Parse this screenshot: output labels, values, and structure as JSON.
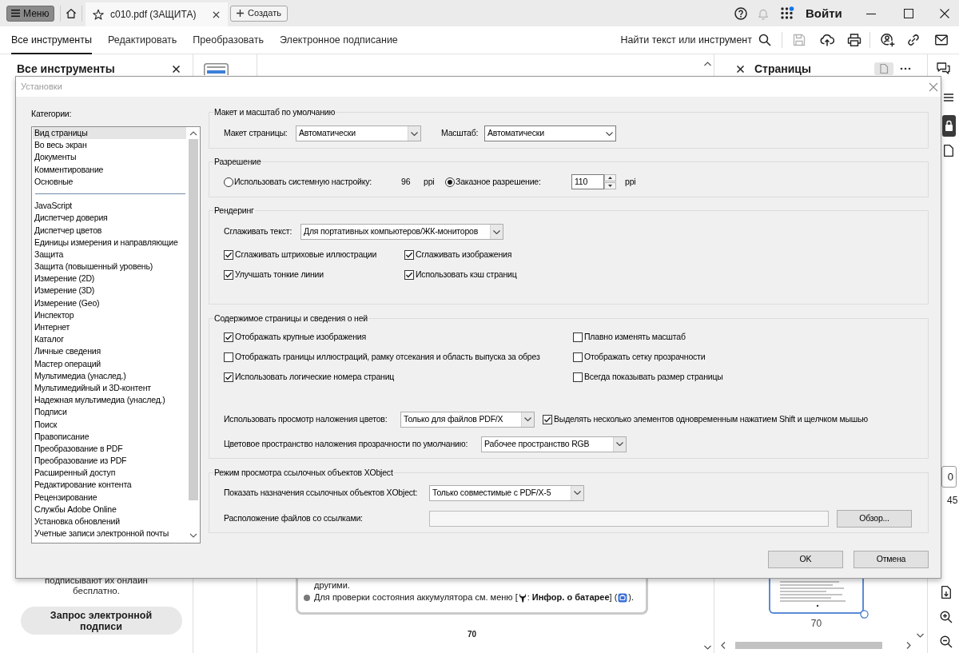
{
  "title_bar": {
    "menu_button": "Меню",
    "document_tab": "c010.pdf (ЗАЩИТА)",
    "create_button": "Создать",
    "sign_in": "Войти"
  },
  "toolbar": {
    "tabs": [
      {
        "label": "Все инструменты",
        "selected": true
      },
      {
        "label": "Редактировать",
        "selected": false
      },
      {
        "label": "Преобразовать",
        "selected": false
      },
      {
        "label": "Электронное подписание",
        "selected": false
      }
    ],
    "search": "Найти текст или инструмент"
  },
  "tools_panel": {
    "title": "Все инструменты",
    "note": "подписывают их онлайн бесплатно.",
    "request_button": "Запрос электронной подписи"
  },
  "document": {
    "continued_line": "другими.",
    "bullet_parts": [
      "Для проверки состояния аккумулятора см. меню [",
      ": **Инфор. о батарее**] (",
      ")."
    ],
    "page_number": "70"
  },
  "pages_panel": {
    "title": "Страницы",
    "thumbnail_label": "70"
  },
  "right_rail": {
    "page_field": "0",
    "page_count": "45"
  },
  "dialog": {
    "title": "Установки",
    "categories_label": "Категории:",
    "categories": {
      "pinned": [
        {
          "label": "Вид страницы",
          "selected": true
        },
        {
          "label": "Во весь экран",
          "selected": false
        },
        {
          "label": "Документы",
          "selected": false
        },
        {
          "label": "Комментирование",
          "selected": false
        },
        {
          "label": "Основные",
          "selected": false
        }
      ],
      "others": [
        {
          "label": "JavaScript",
          "selected": false
        },
        {
          "label": "Диспетчер доверия",
          "selected": false
        },
        {
          "label": "Диспетчер цветов",
          "selected": false
        },
        {
          "label": "Единицы измерения и направляющие",
          "selected": false
        },
        {
          "label": "Защита",
          "selected": false
        },
        {
          "label": "Защита (повышенный уровень)",
          "selected": false
        },
        {
          "label": "Измерение (2D)",
          "selected": false
        },
        {
          "label": "Измерение (3D)",
          "selected": false
        },
        {
          "label": "Измерение (Geo)",
          "selected": false
        },
        {
          "label": "Инспектор",
          "selected": false
        },
        {
          "label": "Интернет",
          "selected": false
        },
        {
          "label": "Каталог",
          "selected": false
        },
        {
          "label": "Личные сведения",
          "selected": false
        },
        {
          "label": "Мастер операций",
          "selected": false
        },
        {
          "label": "Мультимедиа (унаслед.)",
          "selected": false
        },
        {
          "label": "Мультимедийный и 3D-контент",
          "selected": false
        },
        {
          "label": "Надежная мультимедиа (унаслед.)",
          "selected": false
        },
        {
          "label": "Подписи",
          "selected": false
        },
        {
          "label": "Поиск",
          "selected": false
        },
        {
          "label": "Правописание",
          "selected": false
        },
        {
          "label": "Преобразование в PDF",
          "selected": false
        },
        {
          "label": "Преобразование из PDF",
          "selected": false
        },
        {
          "label": "Расширенный доступ",
          "selected": false
        },
        {
          "label": "Редактирование контента",
          "selected": false
        },
        {
          "label": "Рецензирование",
          "selected": false
        },
        {
          "label": "Службы Adobe Online",
          "selected": false
        },
        {
          "label": "Установка обновлений",
          "selected": false
        },
        {
          "label": "Учетные записи электронной почты",
          "selected": false
        }
      ]
    },
    "layout_zoom": {
      "title": "Макет и масштаб по умолчанию",
      "page_layout": {
        "label": "Макет страницы:",
        "value": "Автоматически"
      },
      "zoom": {
        "label": "Масштаб:",
        "value": "Автоматически"
      }
    },
    "resolution": {
      "title": "Разрешение",
      "options": [
        {
          "kind": "system",
          "label": "Использовать системную настройку:",
          "value": "96",
          "unit": "ppi",
          "selected": false
        },
        {
          "kind": "custom",
          "label": "Заказное разрешение:",
          "value": "110",
          "unit": "ppi",
          "selected": true
        }
      ]
    },
    "rendering": {
      "title": "Рендеринг",
      "smooth_text": {
        "label": "Сглаживать текст:",
        "value": "Для портативных компьютеров/ЖК-мониторов"
      },
      "options": [
        {
          "label": "Сглаживать штриховые иллюстрации",
          "checked": true
        },
        {
          "label": "Сглаживать изображения",
          "checked": true
        },
        {
          "label": "Улучшать тонкие линии",
          "checked": true
        },
        {
          "label": "Использовать кэш страниц",
          "checked": true
        }
      ]
    },
    "page_content": {
      "title": "Содержимое страницы и сведения о ней",
      "options": [
        {
          "label": "Отображать крупные изображения",
          "checked": true
        },
        {
          "label": "Плавно изменять масштаб",
          "checked": false
        },
        {
          "label": "Отображать границы иллюстраций, рамку отсекания и область выпуска за обрез",
          "checked": false
        },
        {
          "label": "Отображать сетку прозрачности",
          "checked": false
        },
        {
          "label": "Использовать логические номера страниц",
          "checked": true
        },
        {
          "label": "Всегда показывать размер страницы",
          "checked": false
        }
      ],
      "overprint": {
        "label": "Использовать просмотр наложения цветов:",
        "value": "Только для файлов PDF/X"
      },
      "shift_select": {
        "label": "Выделять несколько элементов одновременным нажатием Shift и щелчком мышью",
        "checked": true
      },
      "blend_space": {
        "label": "Цветовое пространство наложения прозрачности по умолчанию:",
        "value": "Рабочее пространство RGB"
      }
    },
    "xobject": {
      "title": "Режим просмотра ссылочных объектов XObject",
      "targets": {
        "label": "Показать назначения ссылочных объектов XObject:",
        "value": "Только совместимые с PDF/X-5"
      },
      "files_location": {
        "label": "Расположение файлов со ссылками:",
        "disabled": true
      },
      "browse_button": "Обзор..."
    },
    "buttons": [
      "OK",
      "Отмена"
    ]
  }
}
